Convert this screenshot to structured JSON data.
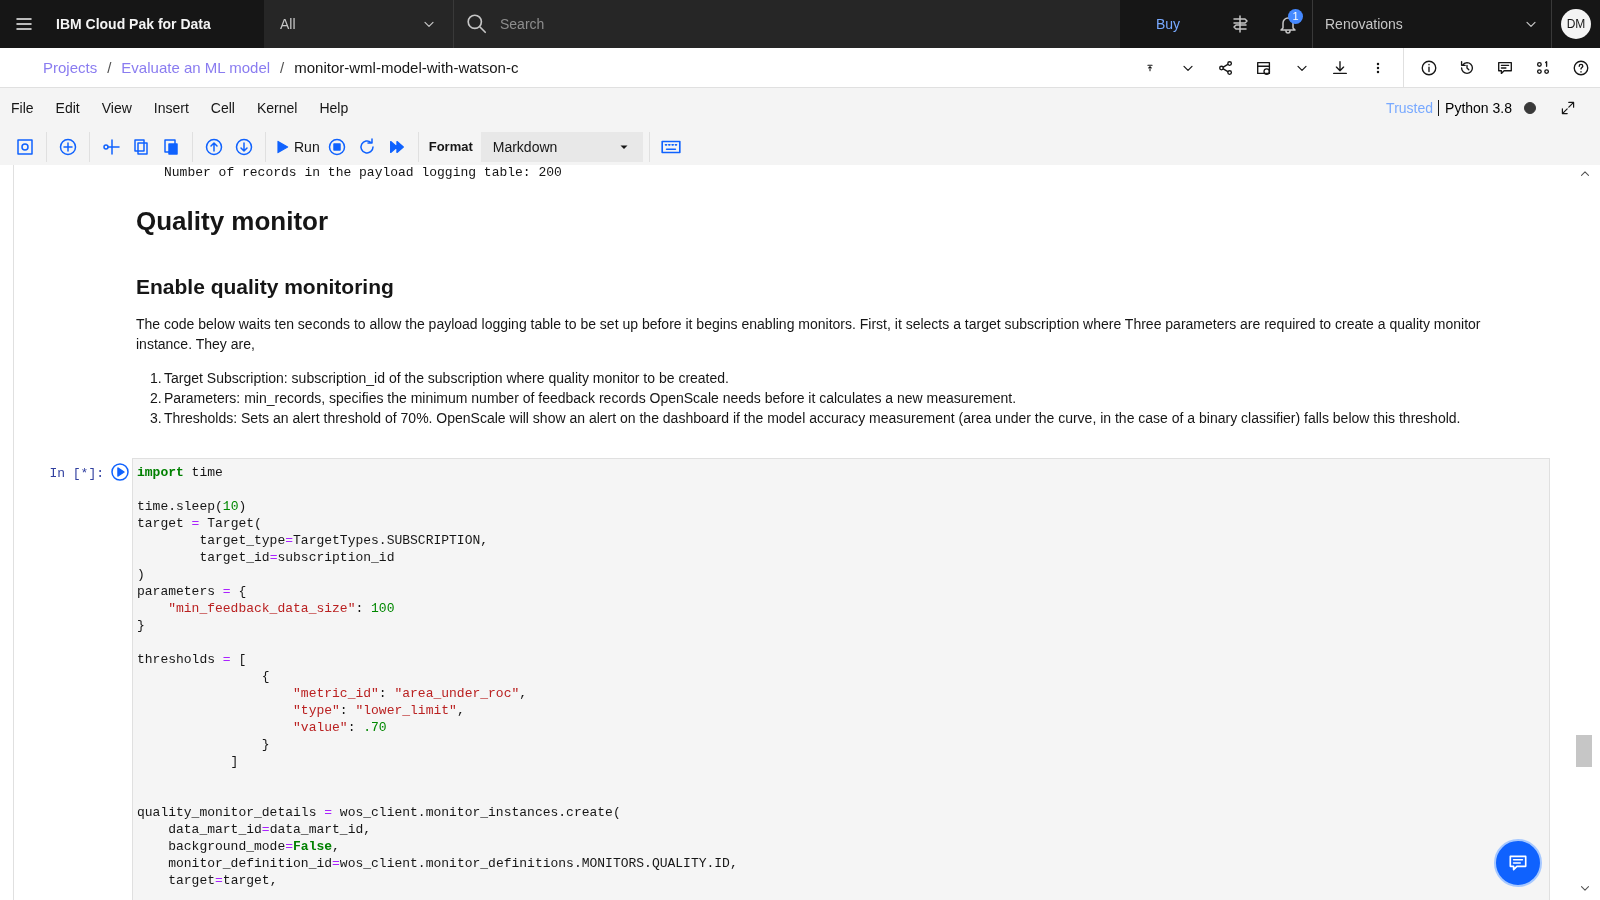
{
  "header": {
    "brand": "IBM Cloud Pak for Data",
    "scope": "All",
    "search_placeholder": "Search",
    "buy": "Buy",
    "notifications": "1",
    "account": "Renovations",
    "avatar": "DM"
  },
  "breadcrumbs": [
    {
      "label": "Projects",
      "link": true
    },
    {
      "separator": "/",
      "label": "Evaluate an ML model",
      "link": true
    },
    {
      "separator": "/",
      "label": "monitor-wml-model-with-watson-c",
      "link": false
    }
  ],
  "menu": [
    "File",
    "Edit",
    "View",
    "Insert",
    "Cell",
    "Kernel",
    "Help"
  ],
  "kernel": {
    "trusted": "Trusted",
    "name": "Python 3.8",
    "busy": true
  },
  "toolbar": {
    "run": "Run",
    "format_label": "Format",
    "format": "Markdown"
  },
  "notebook": {
    "previous_output": "Number of records in the payload logging table: 200",
    "h1": "Quality monitor",
    "h2": "Enable quality monitoring",
    "paragraph": "The code below waits ten seconds to allow the payload logging table to be set up before it begins enabling monitors. First, it selects a target subscription where Three parameters are required to create a quality monitor instance. They are,",
    "list": [
      {
        "number": "1.",
        "text": "Target Subscription: subscription_id of the subscription where quality monitor to be created."
      },
      {
        "number": "2.",
        "text": "Parameters: min_records, specifies the minimum number of feedback records OpenScale needs before it calculates a new measurement."
      },
      {
        "number": "3.",
        "text": "Thresholds: Sets an alert threshold of 70%. OpenScale will show an alert on the dashboard if the model accuracy measurement (area under the curve, in the case of a binary classifier) falls below this threshold."
      }
    ],
    "cell": {
      "prompt": "In [*]:",
      "lines": [
        {
          "kind": "code",
          "tokens": [
            {
              "kind": "kw",
              "text": "import"
            },
            {
              "kind": "plain",
              "text": " time"
            }
          ]
        },
        {
          "kind": "blank"
        },
        {
          "kind": "code",
          "tokens": [
            {
              "kind": "plain",
              "text": "time.sleep("
            },
            {
              "kind": "num",
              "text": "10"
            },
            {
              "kind": "plain",
              "text": ")"
            }
          ]
        },
        {
          "kind": "code",
          "tokens": [
            {
              "kind": "plain",
              "text": "target "
            },
            {
              "kind": "op",
              "text": "="
            },
            {
              "kind": "plain",
              "text": " Target("
            }
          ]
        },
        {
          "kind": "code",
          "tokens": [
            {
              "kind": "plain",
              "text": "        target_type"
            },
            {
              "kind": "op",
              "text": "="
            },
            {
              "kind": "plain",
              "text": "TargetTypes.SUBSCRIPTION,"
            }
          ]
        },
        {
          "kind": "code",
          "tokens": [
            {
              "kind": "plain",
              "text": "        target_id"
            },
            {
              "kind": "op",
              "text": "="
            },
            {
              "kind": "plain",
              "text": "subscription_id"
            }
          ]
        },
        {
          "kind": "code",
          "tokens": [
            {
              "kind": "plain",
              "text": ")"
            }
          ]
        },
        {
          "kind": "code",
          "tokens": [
            {
              "kind": "plain",
              "text": "parameters "
            },
            {
              "kind": "op",
              "text": "="
            },
            {
              "kind": "plain",
              "text": " {"
            }
          ]
        },
        {
          "kind": "code",
          "tokens": [
            {
              "kind": "str",
              "text": "    \"min_feedback_data_size\""
            },
            {
              "kind": "plain",
              "text": ": "
            },
            {
              "kind": "num",
              "text": "100"
            }
          ]
        },
        {
          "kind": "code",
          "tokens": [
            {
              "kind": "plain",
              "text": "}"
            }
          ]
        },
        {
          "kind": "blank"
        },
        {
          "kind": "code",
          "tokens": [
            {
              "kind": "plain",
              "text": "thresholds "
            },
            {
              "kind": "op",
              "text": "="
            },
            {
              "kind": "plain",
              "text": " ["
            }
          ]
        },
        {
          "kind": "code",
          "tokens": [
            {
              "kind": "plain",
              "text": "                {"
            }
          ]
        },
        {
          "kind": "code",
          "tokens": [
            {
              "kind": "str",
              "text": "                    \"metric_id\""
            },
            {
              "kind": "plain",
              "text": ": "
            },
            {
              "kind": "str",
              "text": "\"area_under_roc\""
            },
            {
              "kind": "plain",
              "text": ","
            }
          ]
        },
        {
          "kind": "code",
          "tokens": [
            {
              "kind": "str",
              "text": "                    \"type\""
            },
            {
              "kind": "plain",
              "text": ": "
            },
            {
              "kind": "str",
              "text": "\"lower_limit\""
            },
            {
              "kind": "plain",
              "text": ","
            }
          ]
        },
        {
          "kind": "code",
          "tokens": [
            {
              "kind": "str",
              "text": "                    \"value\""
            },
            {
              "kind": "plain",
              "text": ": "
            },
            {
              "kind": "num",
              "text": ".70"
            }
          ]
        },
        {
          "kind": "code",
          "tokens": [
            {
              "kind": "plain",
              "text": "                }"
            }
          ]
        },
        {
          "kind": "code",
          "tokens": [
            {
              "kind": "plain",
              "text": "            ]"
            }
          ]
        },
        {
          "kind": "blank"
        },
        {
          "kind": "blank"
        },
        {
          "kind": "code",
          "tokens": [
            {
              "kind": "plain",
              "text": "quality_monitor_details "
            },
            {
              "kind": "op",
              "text": "="
            },
            {
              "kind": "plain",
              "text": " wos_client.monitor_instances.create("
            }
          ]
        },
        {
          "kind": "code",
          "tokens": [
            {
              "kind": "plain",
              "text": "    data_mart_id"
            },
            {
              "kind": "op",
              "text": "="
            },
            {
              "kind": "plain",
              "text": "data_mart_id,"
            }
          ]
        },
        {
          "kind": "code",
          "tokens": [
            {
              "kind": "plain",
              "text": "    background_mode"
            },
            {
              "kind": "op",
              "text": "="
            },
            {
              "kind": "kw",
              "text": "False"
            },
            {
              "kind": "plain",
              "text": ","
            }
          ]
        },
        {
          "kind": "code",
          "tokens": [
            {
              "kind": "plain",
              "text": "    monitor_definition_id"
            },
            {
              "kind": "op",
              "text": "="
            },
            {
              "kind": "plain",
              "text": "wos_client.monitor_definitions.MONITORS.QUALITY.ID,"
            }
          ]
        },
        {
          "kind": "code",
          "tokens": [
            {
              "kind": "plain",
              "text": "    target"
            },
            {
              "kind": "op",
              "text": "="
            },
            {
              "kind": "plain",
              "text": "target,"
            }
          ]
        }
      ]
    }
  }
}
